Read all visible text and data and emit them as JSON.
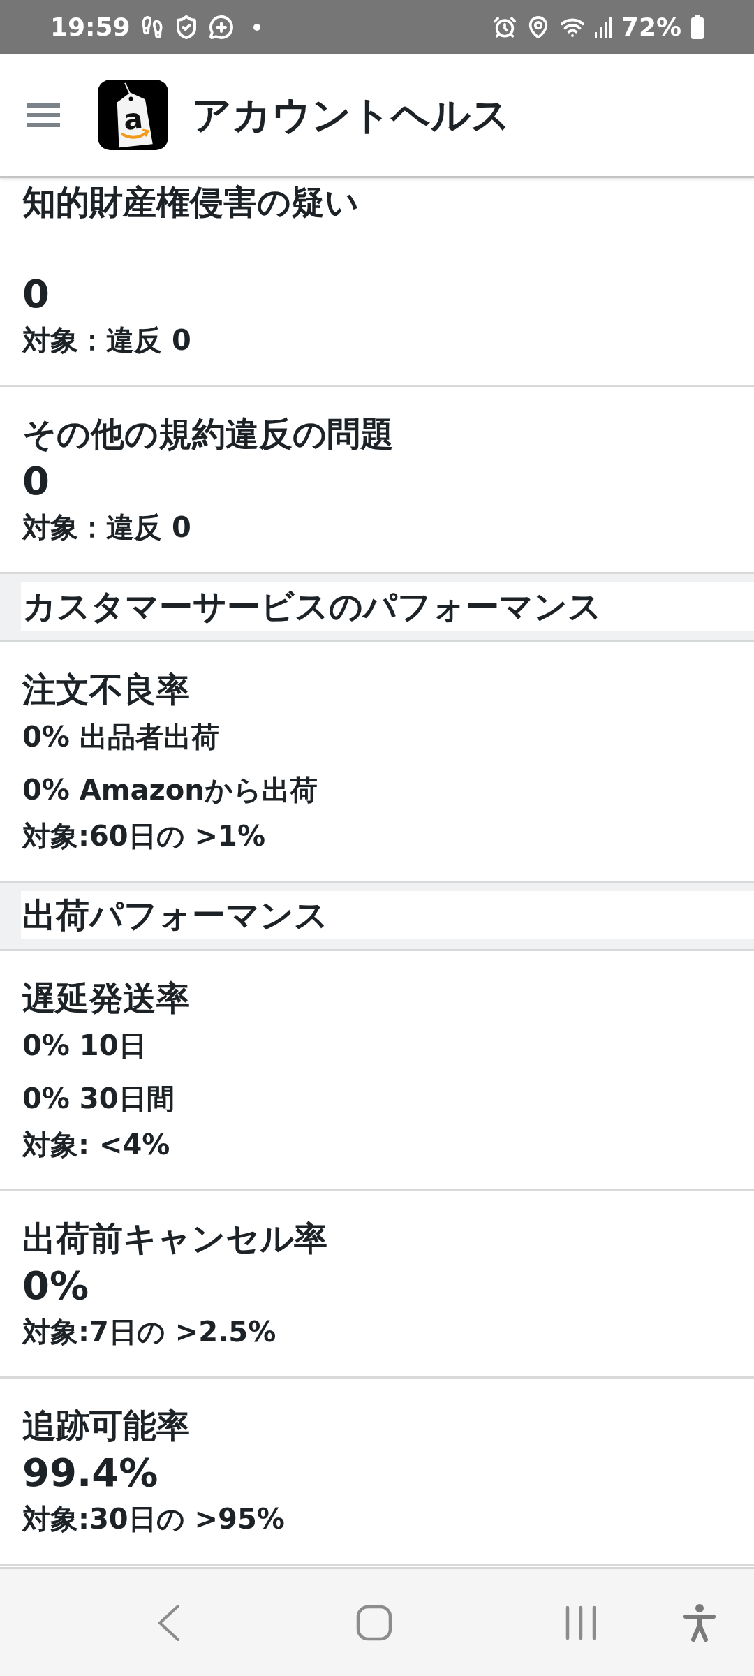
{
  "status_bar": {
    "time": "19:59",
    "battery": "72%"
  },
  "header": {
    "logo_text": "a",
    "title": "アカウントヘルス"
  },
  "blocks": [
    {
      "kind": "card",
      "title": "知的財産権侵害の疑い",
      "values": [
        {
          "kind": "figure",
          "text": "0"
        }
      ],
      "target": "対象：違反 0"
    },
    {
      "kind": "card",
      "title": "その他の規約違反の問題",
      "values": [
        {
          "kind": "figure",
          "text": "0"
        }
      ],
      "target": "対象：違反 0"
    },
    {
      "kind": "section",
      "title": "カスタマーサービスのパフォーマンス"
    },
    {
      "kind": "card",
      "title": "注文不良率",
      "values": [
        {
          "kind": "figure_with_note",
          "text": "**0%** 出品者出荷"
        },
        {
          "kind": "figure_with_note",
          "text": "**0%** Amazonから出荷"
        }
      ],
      "target": "対象:60日の >1%"
    },
    {
      "kind": "section",
      "title": "出荷パフォーマンス"
    },
    {
      "kind": "card",
      "title": "遅延発送率",
      "values": [
        {
          "kind": "figure_with_note",
          "text": "**0%** 10日"
        },
        {
          "kind": "figure_with_note",
          "text": "**0%** 30日間"
        }
      ],
      "target": "対象: <4%"
    },
    {
      "kind": "card",
      "title": "出荷前キャンセル率",
      "values": [
        {
          "kind": "figure",
          "text": "0%"
        }
      ],
      "target": "対象:7日の >2.5%"
    },
    {
      "kind": "card",
      "title": "追跡可能率",
      "values": [
        {
          "kind": "figure",
          "text": "99.4%"
        }
      ],
      "target": "対象:30日の >95%"
    }
  ]
}
